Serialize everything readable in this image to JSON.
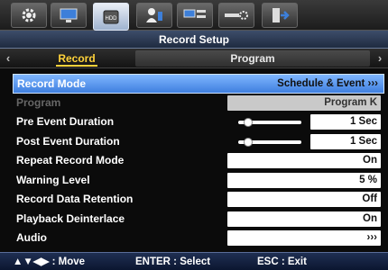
{
  "tabs": [
    {
      "icon": "gear-icon"
    },
    {
      "icon": "monitor-icon"
    },
    {
      "icon": "hdd-icon",
      "text": "HDD"
    },
    {
      "icon": "user-icon"
    },
    {
      "icon": "network-icon"
    },
    {
      "icon": "device-settings-icon"
    },
    {
      "icon": "exit-icon"
    }
  ],
  "title": "Record Setup",
  "subtabs": {
    "active": "Record",
    "inactive": "Program"
  },
  "rows": [
    {
      "label": "Record Mode",
      "value": "Schedule & Event ›››"
    },
    {
      "label": "Program",
      "value": "Program K"
    },
    {
      "label": "Pre Event Duration",
      "value": "1 Sec"
    },
    {
      "label": "Post Event Duration",
      "value": "1 Sec"
    },
    {
      "label": "Repeat Record Mode",
      "value": "On"
    },
    {
      "label": "Warning Level",
      "value": "5 %"
    },
    {
      "label": "Record Data Retention",
      "value": "Off"
    },
    {
      "label": "Playback Deinterlace",
      "value": "On"
    },
    {
      "label": "Audio",
      "value": "›››"
    }
  ],
  "levels": {
    "pre_event": 0.1,
    "post_event": 0.1
  },
  "footer": {
    "move": "▲▼◀▶ : Move",
    "select": "ENTER : Select",
    "exit": "ESC : Exit"
  },
  "colors": {
    "selected": "#5a9bf0",
    "active_tab": "#ffd23a"
  }
}
